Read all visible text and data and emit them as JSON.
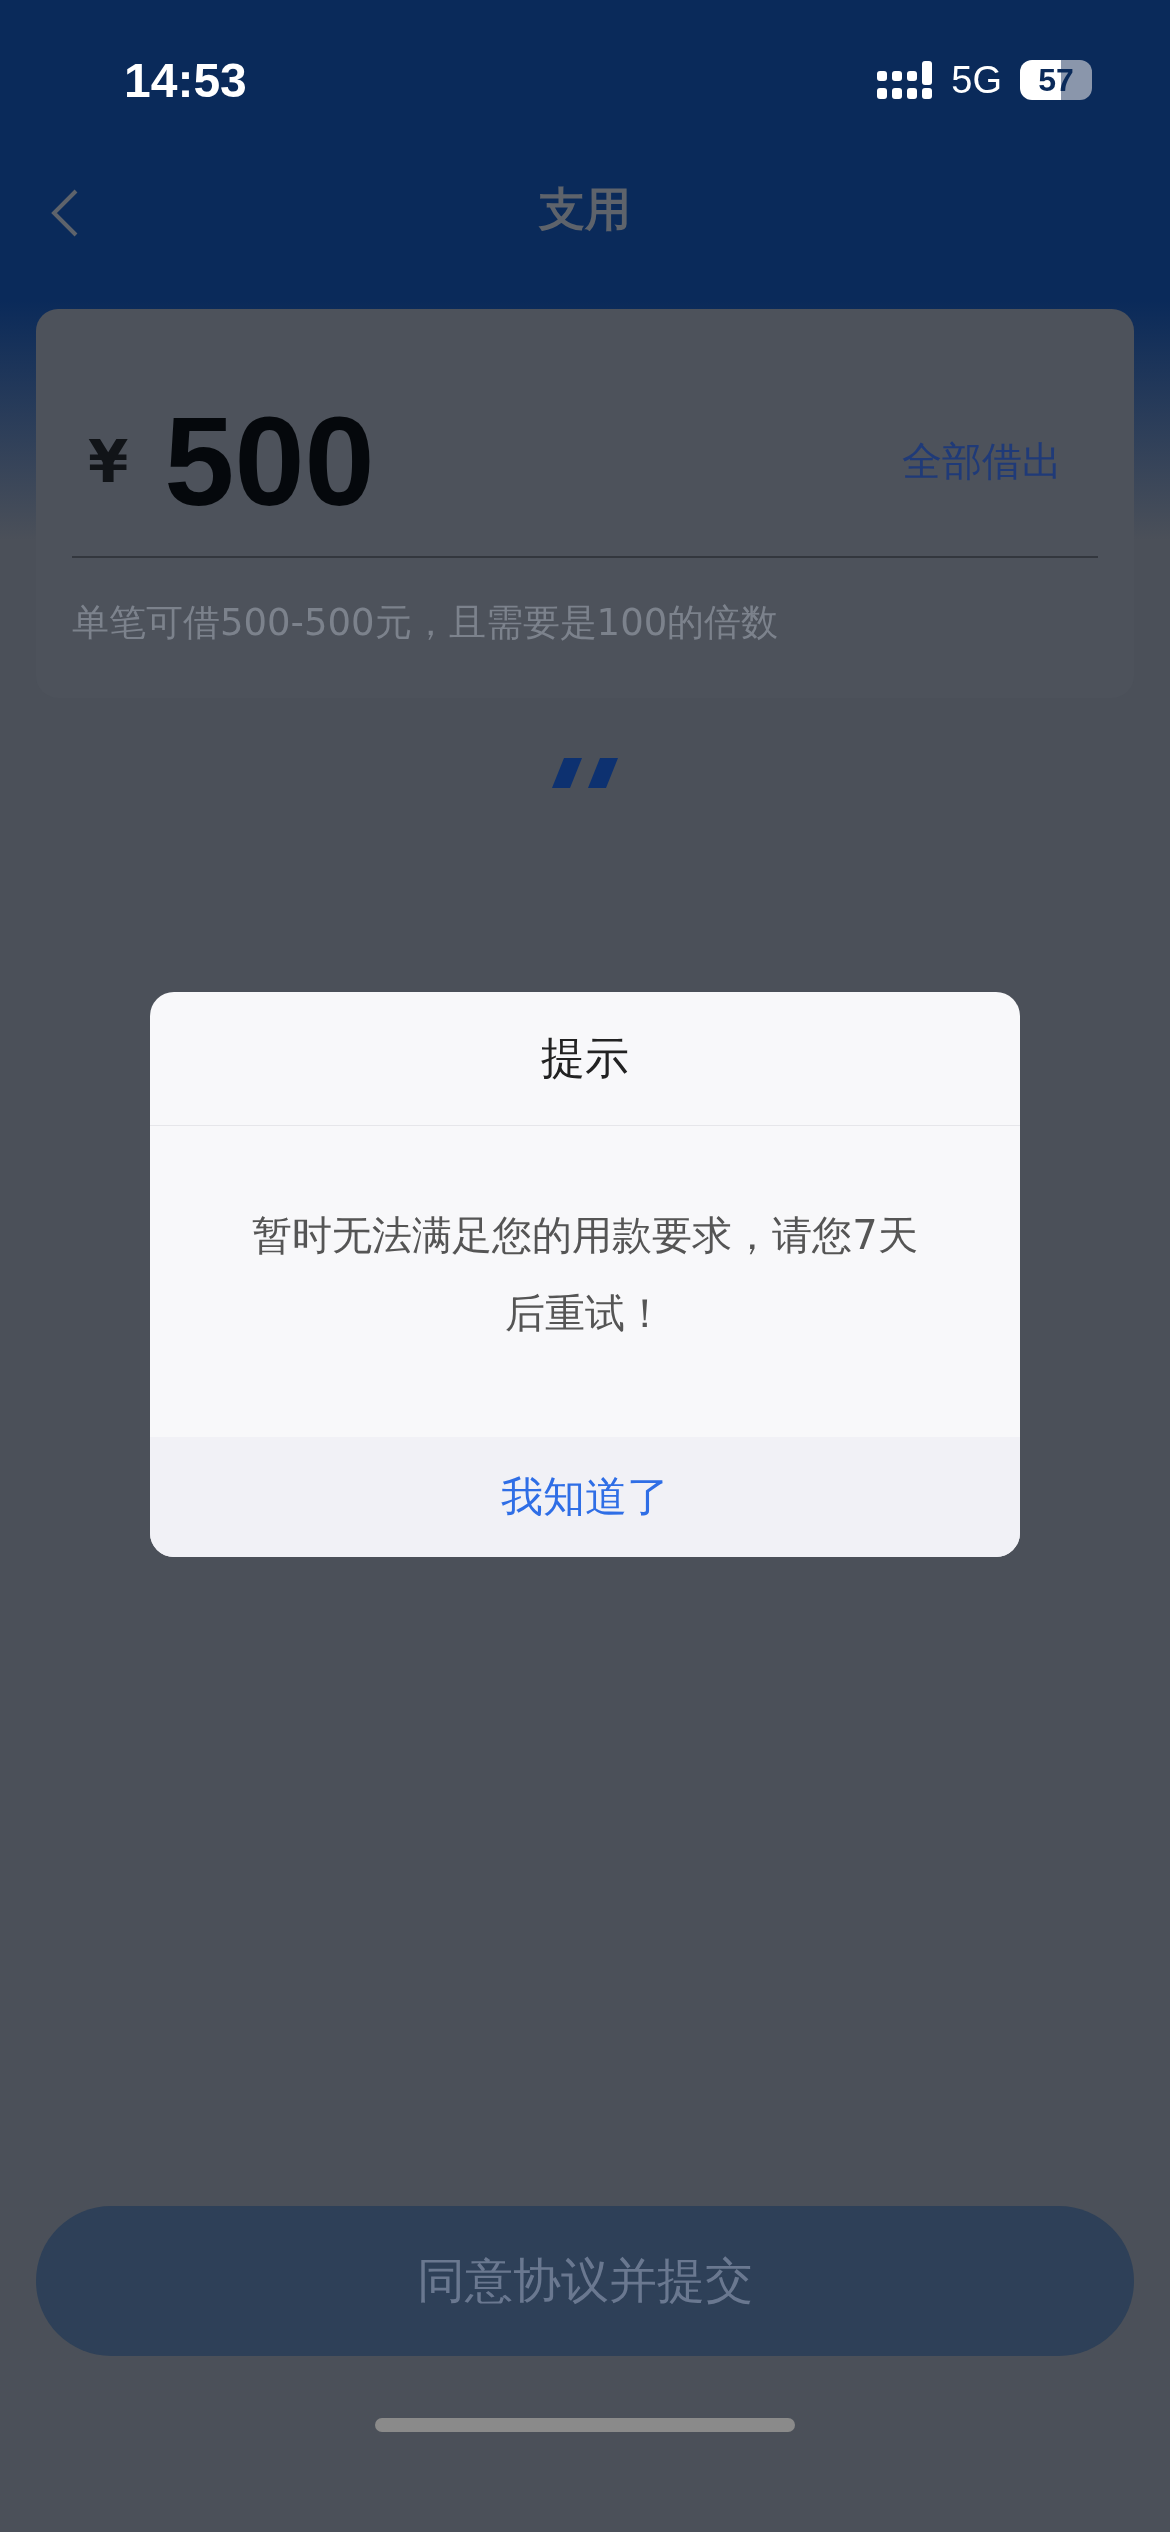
{
  "status_bar": {
    "time": "14:53",
    "network": "5G",
    "battery": "57"
  },
  "nav": {
    "title": "支用"
  },
  "amount": {
    "currency": "¥",
    "value": "500",
    "action": "全部借出"
  },
  "hint": "单笔可借500-500元，且需要是100的倍数",
  "dialog": {
    "title": "提示",
    "message": "暂时无法满足您的用款要求，请您7天后重试！",
    "button": "我知道了"
  },
  "submit_button": {
    "label": "同意协议并提交",
    "disabled": true
  }
}
